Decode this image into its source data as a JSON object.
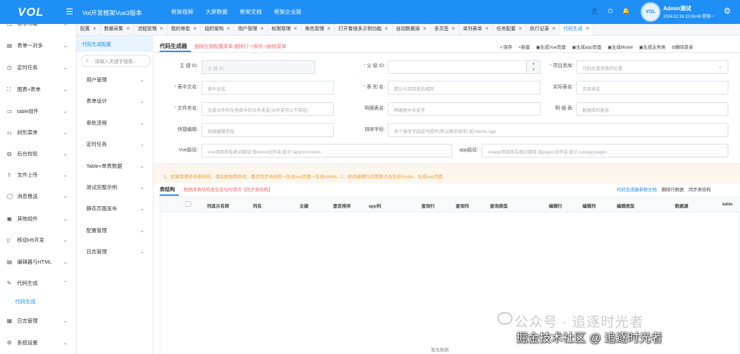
{
  "header": {
    "logo": "VOL",
    "title": "Vol开发框架Vue3版本",
    "nav": [
      "框架视频",
      "大屏数据",
      "框架文档",
      "框架企业版"
    ],
    "user": {
      "avatar_text": "VOL",
      "name": "Admin测试",
      "datetime": "2024.02.26 22:06:48 星期一"
    }
  },
  "tabs": [
    {
      "label": "配置"
    },
    {
      "label": "数据采集"
    },
    {
      "label": "流程管理"
    },
    {
      "label": "我的审批"
    },
    {
      "label": "组织架构"
    },
    {
      "label": "用户管理"
    },
    {
      "label": "权限管理"
    },
    {
      "label": "角色管理"
    },
    {
      "label": "打开看很多示例功能"
    },
    {
      "label": "自动数据源"
    },
    {
      "label": "多页签"
    },
    {
      "label": "单列表单"
    },
    {
      "label": "任务配置"
    },
    {
      "label": "执行记录"
    },
    {
      "label": "代码生成",
      "active": true
    }
  ],
  "sidebar": {
    "items": [
      {
        "icon": "▢",
        "label": "表单布局"
      },
      {
        "icon": "▤",
        "label": "表单一对多"
      },
      {
        "icon": "◷",
        "label": "定时任务"
      },
      {
        "icon": "⛶",
        "label": "图表+表单"
      },
      {
        "icon": "▭",
        "label": "table组件"
      },
      {
        "icon": "⚏",
        "label": "树形菜单"
      },
      {
        "icon": "◍",
        "label": "后台校验"
      },
      {
        "icon": "⇪",
        "label": "文件上传"
      },
      {
        "icon": "◯",
        "label": "消息推送"
      },
      {
        "icon": "▣",
        "label": "其他组件"
      },
      {
        "icon": "▯",
        "label": "移动H5开发"
      },
      {
        "icon": "▤",
        "label": "编辑器与HTML"
      },
      {
        "icon": "✎",
        "label": "代码生成"
      },
      {
        "icon": "",
        "label": "代码生成"
      },
      {
        "icon": "▦",
        "label": "日志管理"
      },
      {
        "icon": "⚙",
        "label": "系统设置"
      }
    ]
  },
  "midnav": {
    "header": "代码生成配置",
    "search_placeholder": "请输入关键字搜索...",
    "items": [
      "用户管理",
      "表单设计",
      "审批流程",
      "定时任务",
      "Table+单表数据",
      "测试完整示例",
      "静态页面发布",
      "配置管理",
      "日志管理"
    ]
  },
  "content": {
    "title": "代码生成器",
    "note": "删除左侧配置菜单:删除行->保存->删除菜单",
    "actions": [
      "✓保存",
      "+新建",
      "▣生成Vue页面",
      "▣生成app页面",
      "▣生成Model",
      "▣生成业务类",
      "⊟删除菜单"
    ],
    "form": {
      "primary_key": {
        "label": "主 键 ID:",
        "placeholder": "主 键 ID"
      },
      "parent_id": {
        "label": "父 级 ID:",
        "value": ""
      },
      "project_type": {
        "label": "项目类库:",
        "placeholder": "代码生成存放的位置"
      },
      "table_cn_name": {
        "label": "表中文名:",
        "placeholder": "表中文名"
      },
      "table_alias": {
        "label": "表 别 名:",
        "placeholder": "默认与实际表名相同"
      },
      "real_table_name": {
        "label": "实际表名:",
        "placeholder": "实际表名"
      },
      "folder_name": {
        "label": "文件夹名:",
        "placeholder": "生成文件所在类库中的文件夹名(文件夹可以不存在)"
      },
      "detail_cn_name": {
        "label": "明细表名:",
        "placeholder": "明细表中文名字"
      },
      "detail_table": {
        "label": "明 细 表:",
        "placeholder": "数据库的表名"
      },
      "quick_edit": {
        "label": "快捷编辑:",
        "placeholder": "快捷编辑字段"
      },
      "sort_field": {
        "label": "排序字段:",
        "placeholder": "多个排序字段逗号隔开(默认降序排序),如:Name,Age"
      },
      "vue_path": {
        "label": "Vue路径:",
        "placeholder": "Vue项目所在绝对路径,到views文件夹,如:E:/app/src/views"
      },
      "app_path": {
        "label": "app路径:",
        "placeholder": "uniapp项目所在绝对路径,到pages文件夹,如:E:/uniapp/pages"
      }
    },
    "tip": "1、如果需要修改表结构，请在数据库修改，再点同步表结构->生成vue页面->生成model。2、修改编辑行后需要点击生成model、生成vue页面"
  },
  "table_structure": {
    "title": "表结构",
    "note": "数据库表结构发生变化时请点【同步表结构】",
    "actions": [
      {
        "label": "代码生成器参数文档",
        "color": "#1e8ff5"
      },
      {
        "label": "删除行数据",
        "color": "#444444"
      },
      {
        "label": "同步表结构",
        "color": "#444444"
      }
    ],
    "columns": [
      "列显示名称",
      "列名",
      "主键",
      "是否排序",
      "app列",
      "查询行",
      "查询列",
      "查询类型",
      "编辑行",
      "编辑列",
      "编辑类型",
      "数据源",
      "table"
    ],
    "empty_text": "暂无数据"
  },
  "watermark": {
    "line1": "公众号 · 追逐时光者",
    "line2": "掘金技术社区 @ 追逐时光者"
  },
  "colors": {
    "primary": "#1e8ff5",
    "danger": "#f56c6c",
    "warning": "#e6a23c",
    "tip_bg": "#fdf6ec"
  }
}
